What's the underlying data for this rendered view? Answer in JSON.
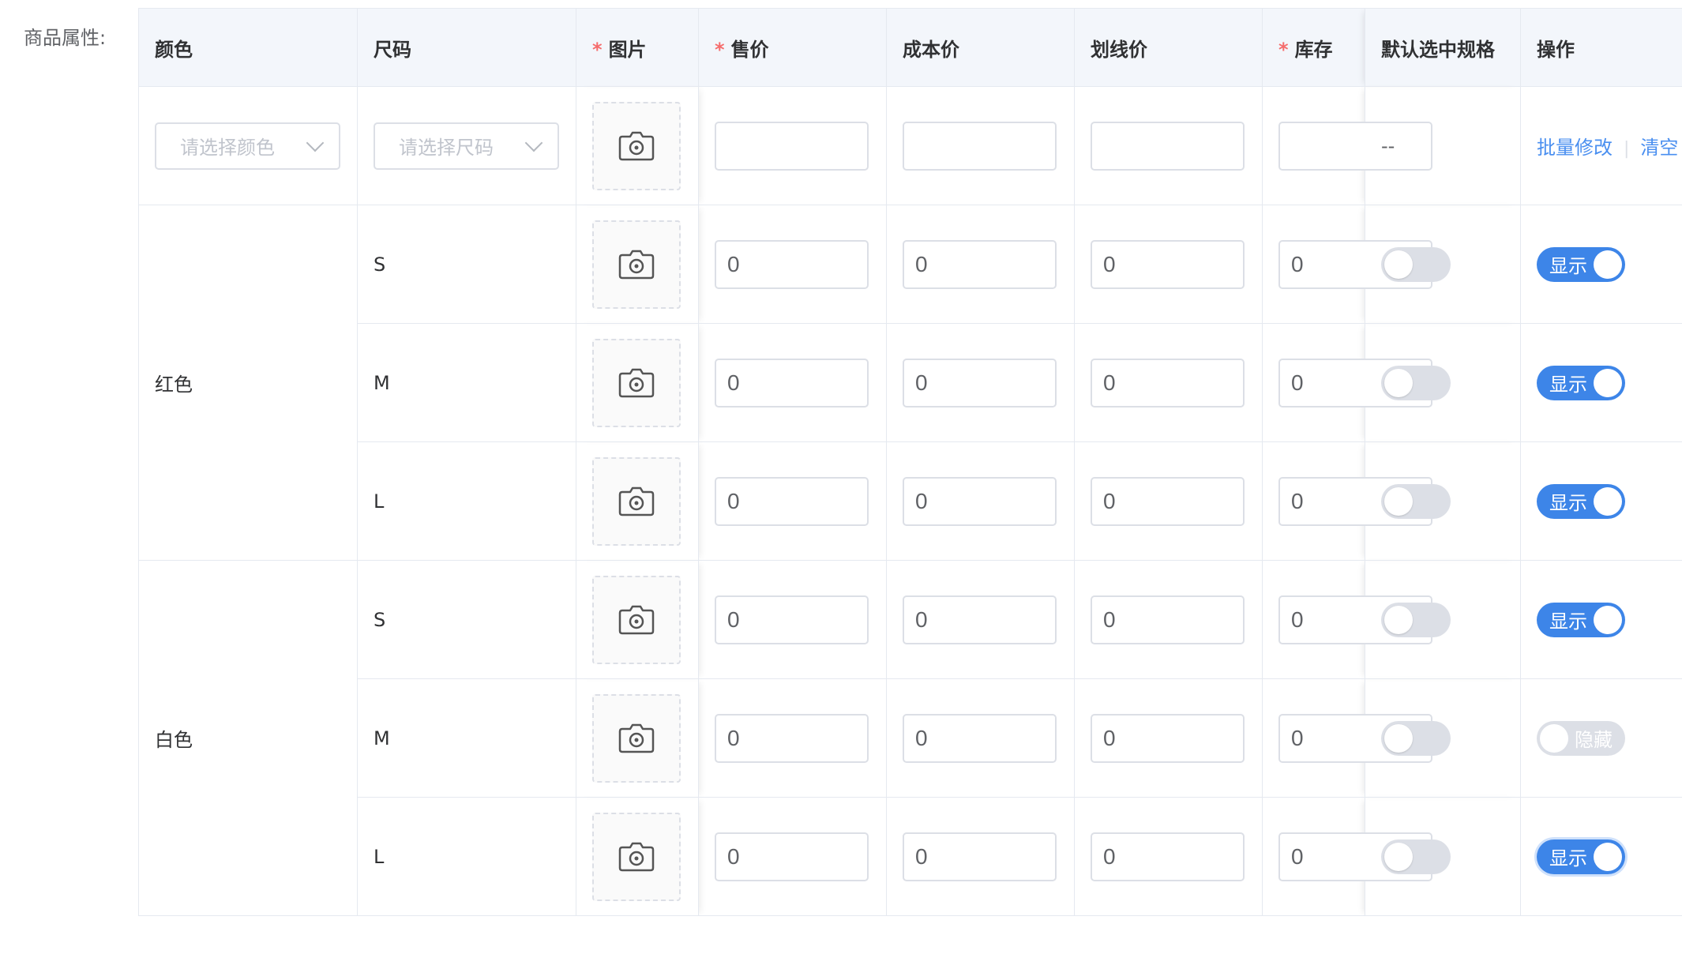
{
  "form": {
    "label": "商品属性:"
  },
  "columns": {
    "color": "颜色",
    "size": "尺码",
    "image": "图片",
    "price": "售价",
    "cost": "成本价",
    "list_price": "划线价",
    "stock": "库存",
    "default_spec": "默认选中规格",
    "ops": "操作",
    "required_mark": "*"
  },
  "batch_row": {
    "color_placeholder": "请选择颜色",
    "size_placeholder": "请选择尺码",
    "default_placeholder": "--",
    "batch_edit": "批量修改",
    "clear": "清空"
  },
  "groups": [
    {
      "color": "红色",
      "rows": [
        {
          "size": "S",
          "price": "0",
          "cost": "0",
          "list_price": "0",
          "stock": "0",
          "default": false,
          "visible": true,
          "status": "显示"
        },
        {
          "size": "M",
          "price": "0",
          "cost": "0",
          "list_price": "0",
          "stock": "0",
          "default": false,
          "visible": true,
          "status": "显示"
        },
        {
          "size": "L",
          "price": "0",
          "cost": "0",
          "list_price": "0",
          "stock": "0",
          "default": false,
          "visible": true,
          "status": "显示"
        }
      ]
    },
    {
      "color": "白色",
      "rows": [
        {
          "size": "S",
          "price": "0",
          "cost": "0",
          "list_price": "0",
          "stock": "0",
          "default": false,
          "visible": true,
          "status": "显示"
        },
        {
          "size": "M",
          "price": "0",
          "cost": "0",
          "list_price": "0",
          "stock": "0",
          "default": false,
          "visible": false,
          "status": "隐藏"
        },
        {
          "size": "L",
          "price": "0",
          "cost": "0",
          "list_price": "0",
          "stock": "0",
          "default": false,
          "visible": true,
          "status": "显示"
        }
      ]
    }
  ],
  "colors": {
    "accent": "#3d85e8",
    "link": "#4a8ff0",
    "required": "#f56c6c",
    "header_bg": "#f3f6fb",
    "toggle_off": "#dcdfe6"
  },
  "icons": {
    "upload": "camera-icon",
    "select": "chevron-down-icon"
  }
}
